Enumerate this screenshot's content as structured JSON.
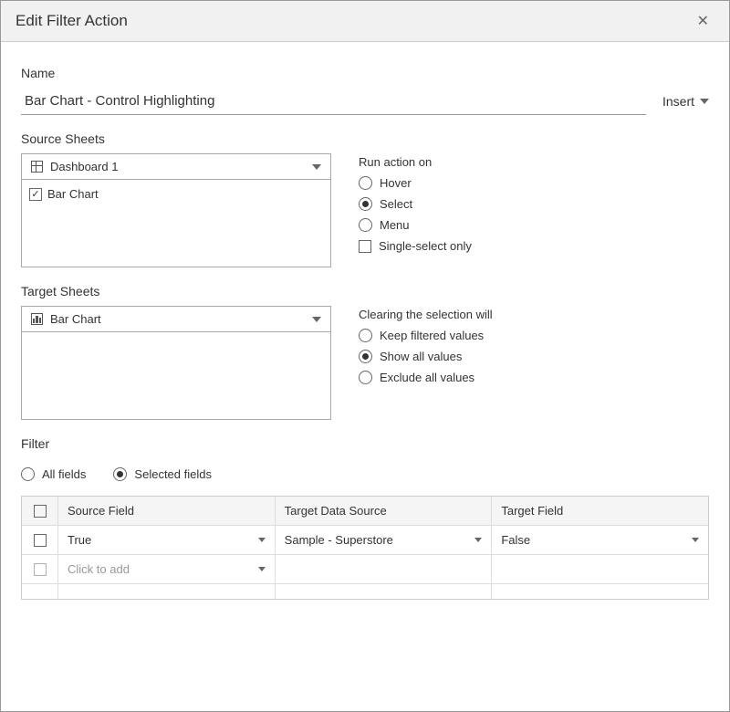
{
  "header": {
    "title": "Edit Filter Action"
  },
  "name_section": {
    "label": "Name",
    "value": "Bar Chart - Control Highlighting",
    "insert_label": "Insert"
  },
  "source": {
    "label": "Source Sheets",
    "dropdown_value": "Dashboard 1",
    "list_items": [
      {
        "label": "Bar Chart",
        "checked": true
      }
    ],
    "run_label": "Run action on",
    "options": {
      "hover": "Hover",
      "select": "Select",
      "menu": "Menu",
      "single_select": "Single-select only"
    },
    "selected_run": "select"
  },
  "target": {
    "label": "Target Sheets",
    "dropdown_value": "Bar Chart",
    "clear_label": "Clearing the selection will",
    "options": {
      "keep": "Keep filtered values",
      "show": "Show all values",
      "exclude": "Exclude all values"
    },
    "selected_clear": "show"
  },
  "filter": {
    "label": "Filter",
    "fields_option_all": "All fields",
    "fields_option_selected": "Selected fields",
    "columns": {
      "source_field": "Source Field",
      "target_ds": "Target Data Source",
      "target_field": "Target Field"
    },
    "rows": [
      {
        "source": "True",
        "target_ds": "Sample - Superstore",
        "target_field": "False",
        "checked": false
      },
      {
        "source": "Click to add",
        "target_ds": "",
        "target_field": "",
        "placeholder": true,
        "checked": false
      }
    ]
  }
}
